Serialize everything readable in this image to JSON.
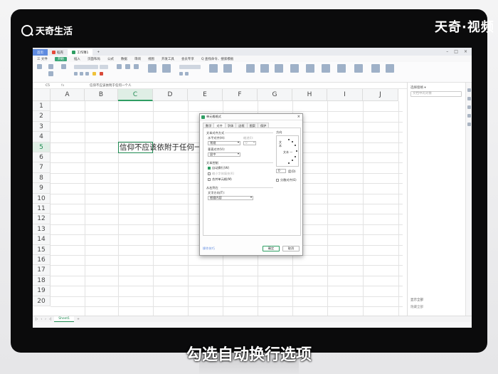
{
  "brand": {
    "name": "天奇生活"
  },
  "watermark": "天奇·视频",
  "subtitle": "勾选自动换行选项",
  "titlebar": {
    "tabs": [
      {
        "label": "首页",
        "color": "#5f8be0"
      },
      {
        "label": "稻壳",
        "color": "#e64a3b"
      },
      {
        "label": "工作簿1",
        "color": "#2f9e63"
      }
    ],
    "add_label": "+"
  },
  "menubar": {
    "items": [
      "三 文件",
      "开始",
      "插入",
      "页面布局",
      "公式",
      "数据",
      "审阅",
      "视图",
      "开发工具",
      "会员专享",
      "Q 查找命令、搜索模板"
    ],
    "active_index": 1
  },
  "formula_bar": {
    "name_box": "C5",
    "fx": "fx",
    "content": "信仰不应该依附于任何一个人"
  },
  "sheet": {
    "columns": [
      "A",
      "B",
      "C",
      "D",
      "E",
      "F",
      "G",
      "H",
      "I",
      "J"
    ],
    "selected_column": "C",
    "rows": [
      "1",
      "2",
      "3",
      "4",
      "5",
      "6",
      "7",
      "8",
      "9",
      "10",
      "11",
      "12",
      "13",
      "14",
      "15",
      "16",
      "17",
      "18",
      "19",
      "20"
    ],
    "selected_row": "5",
    "cell_c5": "信仰不应该依附于任何一"
  },
  "sheet_tabs": {
    "active": "Sheet1",
    "add": "+"
  },
  "right_panel": {
    "title": "选择窗格 ▾",
    "search_placeholder": "文档中的对象",
    "bottom_label": "显示全部",
    "bottom_label2": "隐藏全部"
  },
  "dialog": {
    "title": "单元格格式",
    "tabs": [
      "数字",
      "对齐",
      "字体",
      "边框",
      "图案",
      "保护"
    ],
    "active_tab": "对齐",
    "text_alignment_heading": "文本对齐方式",
    "horizontal_label": "水平对齐(H):",
    "horizontal_value": "常规",
    "indent_label": "缩进(I):",
    "indent_value": "0",
    "vertical_label": "垂直对齐(V):",
    "vertical_value": "居中",
    "text_control_heading": "文本控制",
    "wrap_text": "自动换行(W)",
    "wrap_text_checked": true,
    "shrink_to_fit": "缩小字体填充(K)",
    "merge_cells": "合并单元格(M)",
    "rtl_heading": "从右到左",
    "direction_label": "文字方向(T):",
    "direction_value": "根据内容",
    "orientation_heading": "方向",
    "orientation_vertical": "文本",
    "orientation_word": "文本 —",
    "degree_value": "0",
    "degree_label": "度(D)",
    "distributed_label": "分散对齐(E)",
    "tips_label": "操作技巧",
    "ok_label": "确定",
    "cancel_label": "取消"
  }
}
